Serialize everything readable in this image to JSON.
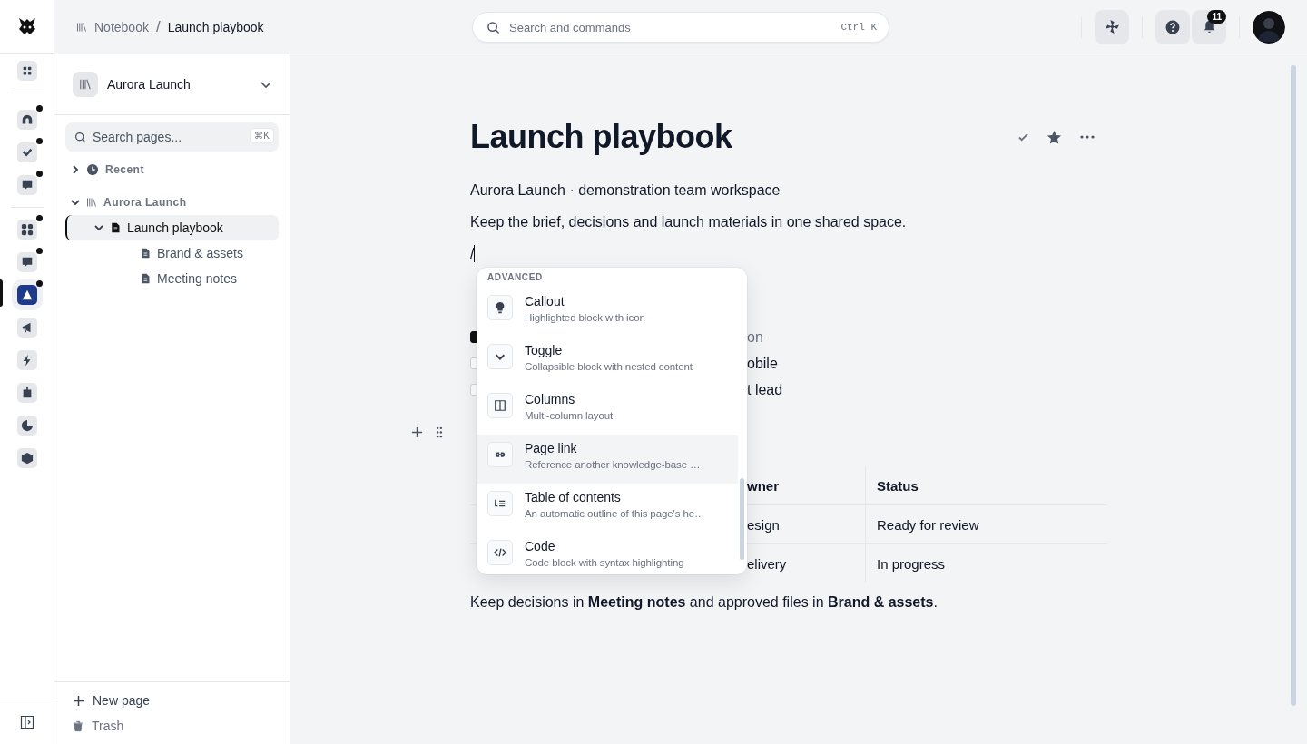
{
  "rail": {
    "items": [
      {
        "unread": false,
        "selected": false
      },
      {
        "unread": true,
        "selected": false
      },
      {
        "unread": true,
        "selected": false
      },
      {
        "unread": true,
        "selected": false
      },
      {
        "unread": true,
        "selected": false
      },
      {
        "unread": true,
        "selected": false
      },
      {
        "unread": true,
        "selected": true
      },
      {
        "unread": false,
        "selected": false
      },
      {
        "unread": false,
        "selected": false
      },
      {
        "unread": false,
        "selected": false
      },
      {
        "unread": false,
        "selected": false
      },
      {
        "unread": false,
        "selected": false
      }
    ]
  },
  "breadcrumb": {
    "separator": "/",
    "items": [
      {
        "label": "Notebook"
      },
      {
        "label": "Launch playbook"
      }
    ]
  },
  "search": {
    "placeholder": "Search and commands",
    "shortcut": "Ctrl K"
  },
  "notifications": {
    "count": "11"
  },
  "sidebar": {
    "workspace": "Aurora Launch",
    "search": {
      "placeholder": "Search pages...",
      "shortcut": "⌘K"
    },
    "tree": [
      {
        "label": "Recent",
        "kind": "recent",
        "expanded": false,
        "selected": false
      },
      {
        "label": "Aurora Launch",
        "kind": "library",
        "expanded": true,
        "selected": false,
        "children": [
          {
            "label": "Launch playbook",
            "kind": "page",
            "expanded": true,
            "selected": true,
            "children": [
              {
                "label": "Brand & assets",
                "kind": "page",
                "selected": false
              },
              {
                "label": "Meeting notes",
                "kind": "page",
                "selected": false
              }
            ]
          }
        ]
      }
    ],
    "footer": [
      {
        "label": "New page",
        "kind": "new"
      },
      {
        "label": "Trash",
        "kind": "trash"
      }
    ]
  },
  "page": {
    "title": "Launch playbook",
    "subtitle": "Aurora Launch · demonstration team workspace",
    "intro": "Keep the brief, decisions and launch materials in one shared space.",
    "command": "/",
    "checklist": [
      {
        "text": "on",
        "checked": true
      },
      {
        "text": "obile",
        "checked": false
      },
      {
        "text": "t lead",
        "checked": false
      }
    ],
    "table": {
      "columns": [
        "wner",
        "Status"
      ],
      "rows": [
        [
          "esign",
          "Ready for review"
        ],
        [
          "elivery",
          "In progress"
        ]
      ]
    },
    "closing": "Keep decisions in **Meeting notes** and approved files in **Brand & assets**."
  },
  "slash_menu": {
    "section": "ADVANCED",
    "items": [
      {
        "title": "Callout",
        "description": "Highlighted block with icon",
        "selected": false
      },
      {
        "title": "Toggle",
        "description": "Collapsible block with nested content",
        "selected": false
      },
      {
        "title": "Columns",
        "description": "Multi-column layout",
        "selected": false
      },
      {
        "title": "Page link",
        "description": "Reference another knowledge-base …",
        "selected": true
      },
      {
        "title": "Table of contents",
        "description": "An automatic outline of this page's he…",
        "selected": false
      },
      {
        "title": "Code",
        "description": "Code block with syntax highlighting",
        "selected": false
      }
    ]
  }
}
